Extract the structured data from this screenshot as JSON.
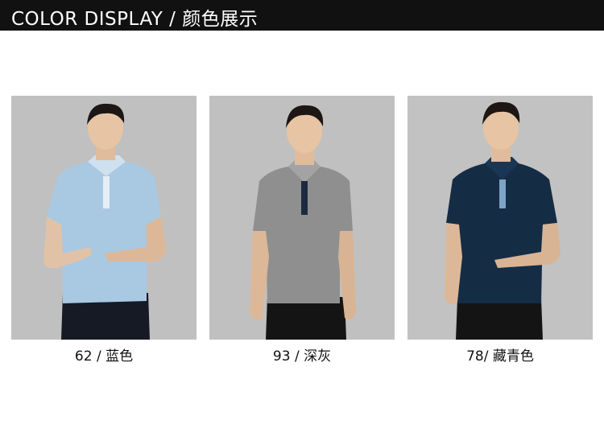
{
  "header": {
    "title": "COLOR DISPLAY / 颜色展示"
  },
  "products": [
    {
      "caption": "62 / 蓝色",
      "shirt_color": "#a9c8e2",
      "collar_color": "#cfe0ee",
      "placket_color": "#e6eef5",
      "pants_color": "#151a24"
    },
    {
      "caption": "93 / 深灰",
      "shirt_color": "#8f8f8f",
      "collar_color": "#a3a3a3",
      "placket_color": "#1c2a40",
      "pants_color": "#141414"
    },
    {
      "caption": "78/ 藏青色",
      "shirt_color": "#152c45",
      "collar_color": "#1b3654",
      "placket_color": "#7ea3c7",
      "pants_color": "#141414"
    }
  ]
}
